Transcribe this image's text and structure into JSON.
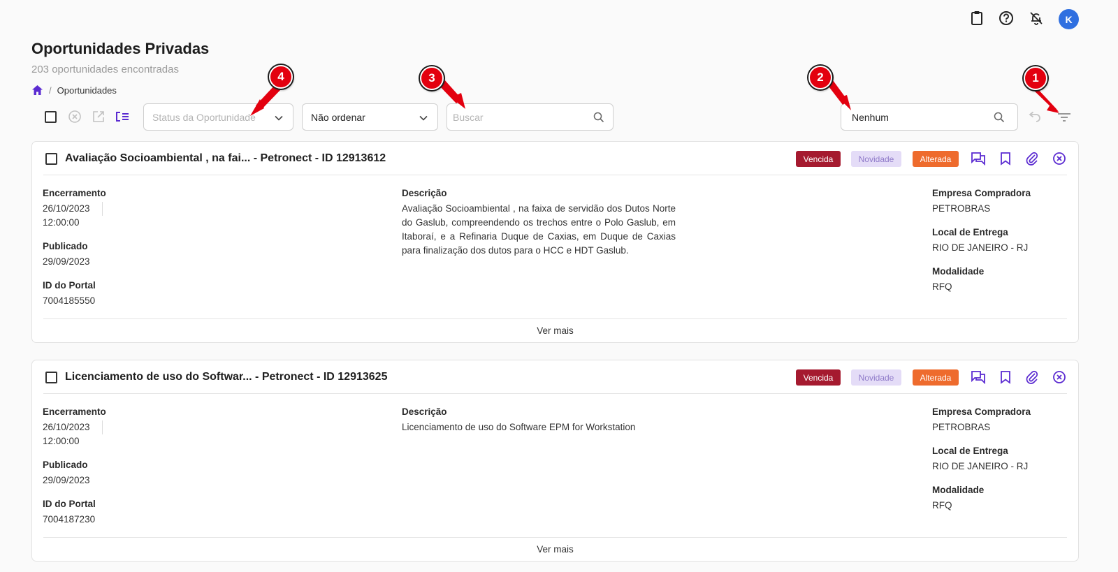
{
  "header": {
    "icons": [
      "clipboard-icon",
      "help-icon",
      "bell-off-icon"
    ],
    "avatar_letter": "K"
  },
  "page": {
    "title": "Oportunidades Privadas",
    "subtitle": "203 oportunidades encontradas"
  },
  "breadcrumb": {
    "home_icon": "home-icon",
    "separator": "/",
    "current": "Oportunidades"
  },
  "toolbar": {
    "status_placeholder": "Status da Oportunidade",
    "sort_value": "Não ordenar",
    "search_placeholder": "Buscar",
    "saved_filter_value": "Nenhum"
  },
  "markers": [
    "1",
    "2",
    "3",
    "4"
  ],
  "cards": [
    {
      "title": "Avaliação Socioambiental , na fai...  - Petronect - ID 12913612",
      "badges": {
        "vencida": "Vencida",
        "novidade": "Novidade",
        "alterada": "Alterada"
      },
      "encerramento_label": "Encerramento",
      "encerramento_date": "26/10/2023",
      "encerramento_time": "12:00:00",
      "publicado_label": "Publicado",
      "publicado": "29/09/2023",
      "id_portal_label": "ID do Portal",
      "id_portal": "7004185550",
      "descricao_label": "Descrição",
      "descricao": "Avaliação Socioambiental , na faixa de servidão dos Dutos Norte do Gaslub, compreendendo os trechos entre o Polo Gaslub, em Itaboraí, e a Refinaria Duque de Caxias, em Duque de Caxias para finalização dos dutos para o HCC e HDT Gaslub.",
      "empresa_label": "Empresa Compradora",
      "empresa": "PETROBRAS",
      "local_label": "Local de Entrega",
      "local": "RIO DE JANEIRO - RJ",
      "modalidade_label": "Modalidade",
      "modalidade": "RFQ",
      "ver_mais": "Ver mais"
    },
    {
      "title": "Licenciamento de uso do Softwar... - Petronect - ID 12913625",
      "badges": {
        "vencida": "Vencida",
        "novidade": "Novidade",
        "alterada": "Alterada"
      },
      "encerramento_label": "Encerramento",
      "encerramento_date": "26/10/2023",
      "encerramento_time": "12:00:00",
      "publicado_label": "Publicado",
      "publicado": "29/09/2023",
      "id_portal_label": "ID do Portal",
      "id_portal": "7004187230",
      "descricao_label": "Descrição",
      "descricao": "Licenciamento de uso do Software EPM for Workstation",
      "empresa_label": "Empresa Compradora",
      "empresa": "PETROBRAS",
      "local_label": "Local de Entrega",
      "local": "RIO DE JANEIRO - RJ",
      "modalidade_label": "Modalidade",
      "modalidade": "RFQ",
      "ver_mais": "Ver mais"
    }
  ],
  "colors": {
    "accent": "#5b2bd1",
    "vencida": "#a51a2f",
    "novidade_bg": "#e4dcf7",
    "alterada": "#ee6b2d",
    "marker": "#e3000f"
  }
}
